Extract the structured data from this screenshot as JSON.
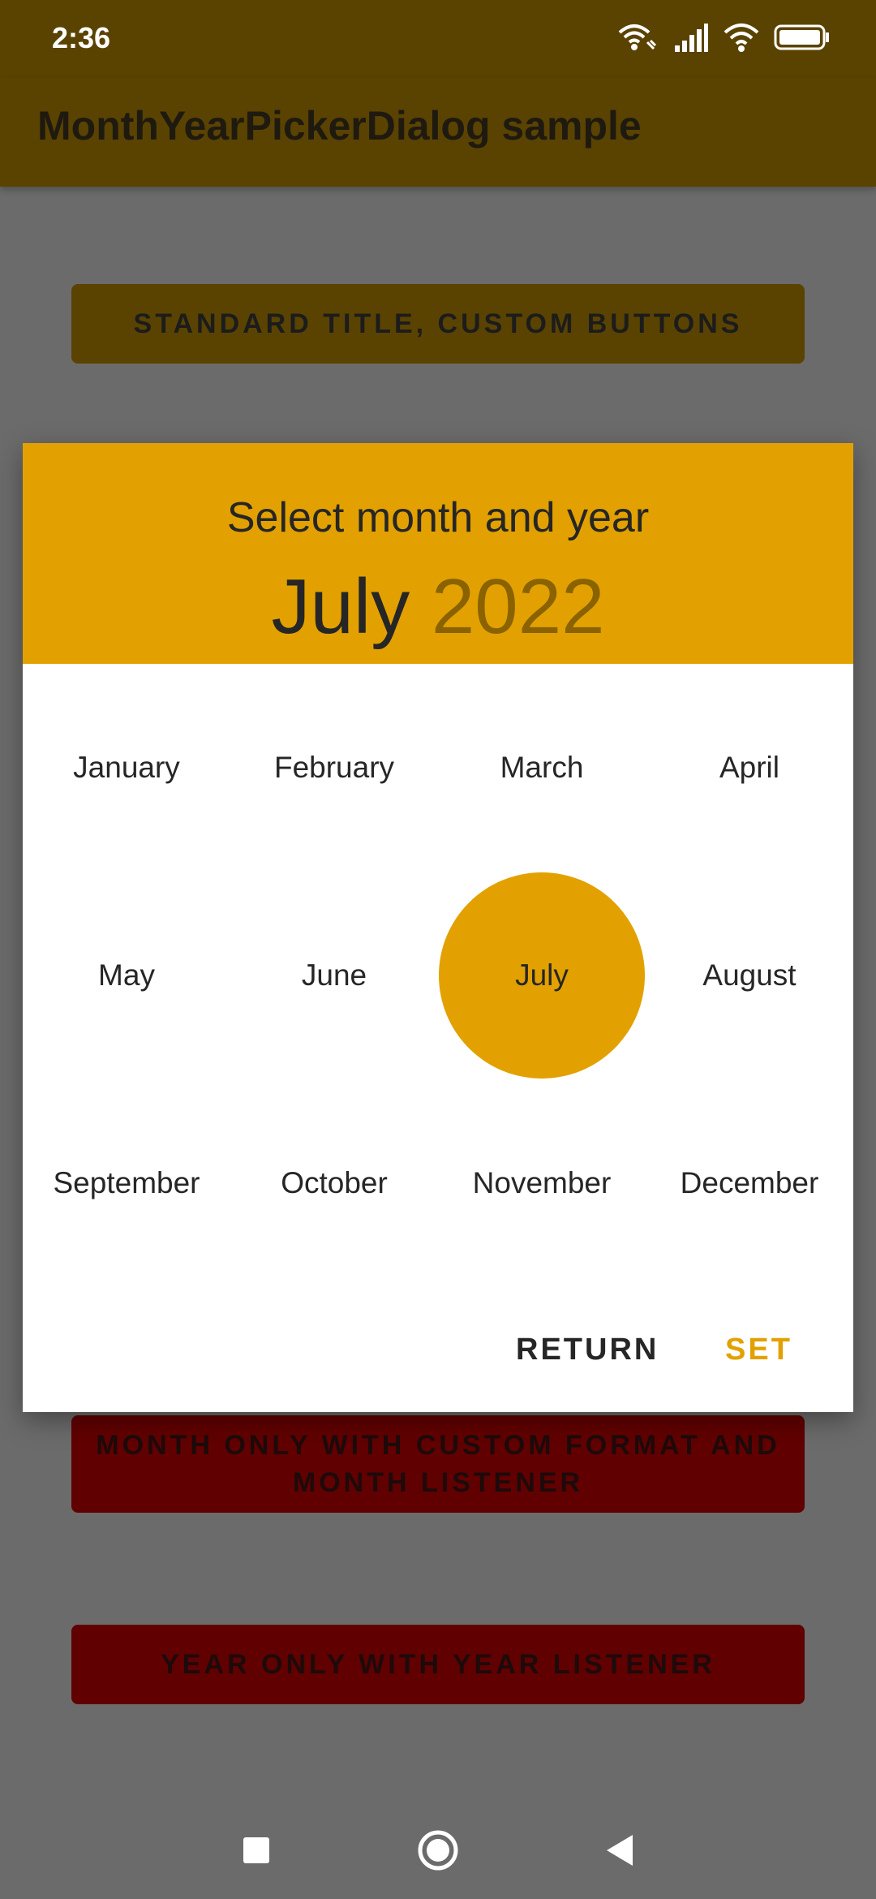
{
  "status_bar": {
    "time": "2:36"
  },
  "app_bar": {
    "title": "MonthYearPickerDialog sample"
  },
  "background_buttons": {
    "standard_title": "STANDARD TITLE, CUSTOM BUTTONS",
    "month_only": "MONTH ONLY WITH CUSTOM FORMAT AND MONTH LISTENER",
    "year_only": "YEAR ONLY WITH YEAR LISTENER"
  },
  "dialog": {
    "title": "Select month and year",
    "selected_month": "July",
    "selected_year": "2022",
    "months": [
      "January",
      "February",
      "March",
      "April",
      "May",
      "June",
      "July",
      "August",
      "September",
      "October",
      "November",
      "December"
    ],
    "selected_index": 6,
    "return_label": "RETURN",
    "set_label": "SET"
  },
  "colors": {
    "accent": "#e2a100",
    "dim_app_bar": "#5a4301",
    "dim_red_button": "#610000",
    "scrim": "#6b6b6b"
  },
  "icons": {
    "status": [
      "wifi-calling-icon",
      "signal-icon",
      "wifi-icon",
      "battery-icon"
    ],
    "nav": [
      "recents-icon",
      "home-icon",
      "back-icon"
    ]
  }
}
